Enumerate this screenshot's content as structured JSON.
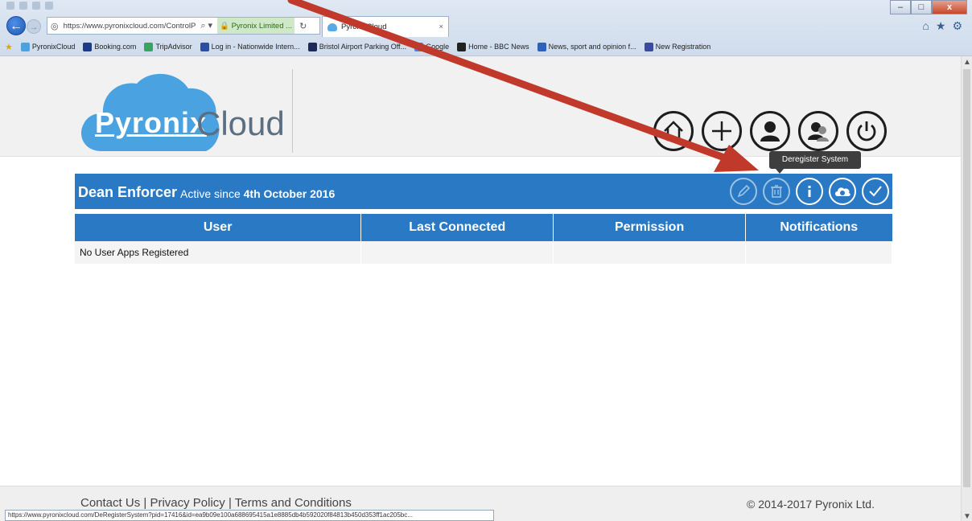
{
  "browser": {
    "address_url": "https://www.pyronixcloud.com/ControlP",
    "address_secure": "Pyronix Limited ...",
    "tab_title": "PyronixCloud",
    "tab_close": "×",
    "back_glyph": "←",
    "forward_glyph": "→",
    "window_buttons": {
      "min": "–",
      "max": "□",
      "close": "x"
    },
    "favorites": [
      {
        "label": "PyronixCloud",
        "color": "#4aa3e0"
      },
      {
        "label": "Booking.com",
        "color": "#1b3a8c"
      },
      {
        "label": "TripAdvisor",
        "color": "#3aa35f"
      },
      {
        "label": "Log in - Nationwide Intern...",
        "color": "#2a4fa5"
      },
      {
        "label": "Bristol Airport Parking Off...",
        "color": "#1e2a5a"
      },
      {
        "label": "Google",
        "color": "#4a7de8"
      },
      {
        "label": "Home - BBC News",
        "color": "#222222"
      },
      {
        "label": "News, sport and opinion f...",
        "color": "#2c62b8"
      },
      {
        "label": "New Registration",
        "color": "#3c4aa0"
      }
    ],
    "status_url": "https://www.pyronixcloud.com/DeRegisterSystem?pid=17416&id=ea9b09e100a688695415a1e8885db4b592020f84813b450d353ff1ac205bc..."
  },
  "header": {
    "logo_brand": "Pyronix",
    "logo_suffix": "Cloud",
    "icons": [
      "home-icon",
      "add-icon",
      "user-icon",
      "users-icon",
      "power-icon"
    ]
  },
  "tooltip": {
    "text": "Deregister System"
  },
  "system": {
    "name": "Dean Enforcer",
    "active_prefix": "Active since",
    "active_date": "4th October 2016",
    "actions": [
      "edit-icon",
      "trash-icon",
      "info-icon",
      "cloud-icon",
      "check-icon"
    ]
  },
  "table": {
    "headers": [
      "User",
      "Last Connected",
      "Permission",
      "Notifications"
    ],
    "rows": [
      [
        "No User Apps Registered",
        "",
        "",
        ""
      ]
    ]
  },
  "footer": {
    "contact": "Contact Us",
    "sep": " | ",
    "privacy": "Privacy Policy",
    "terms": "Terms and Conditions",
    "copyright": "© 2014-2017 Pyronix Ltd."
  },
  "colors": {
    "brand_blue": "#2979c4",
    "arrow_red": "#c0392b"
  }
}
